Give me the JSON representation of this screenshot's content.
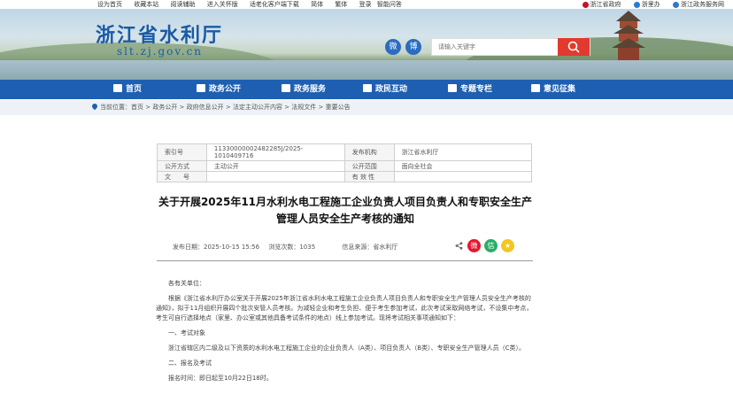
{
  "topbar": {
    "links": [
      "设为首页",
      "收藏本站",
      "阅读辅助",
      "进入关怀版",
      "适老化客户端下载",
      "简体",
      "繁体",
      "登录",
      "智能问答"
    ],
    "right": [
      "浙江省政府",
      "浙里办",
      "浙江政务服务网"
    ]
  },
  "site": {
    "title": "浙江省水利厅",
    "url": "slt.zj.gov.cn"
  },
  "social": {
    "wechat": "微",
    "weibo": "博"
  },
  "search": {
    "placeholder": "请输入关键字"
  },
  "nav": [
    "首页",
    "政务公开",
    "政务服务",
    "政民互动",
    "专题专栏",
    "意见征集"
  ],
  "breadcrumb": {
    "text": "当前位置：首页 > 政务公开 > 政府信息公开 > 法定主动公开内容 > 法规文件 > 重要公告"
  },
  "meta": {
    "index_label": "索引号",
    "index_value": "11330000002482285J/2025-1010409716",
    "publisher_label": "发布机构",
    "publisher_value": "浙江省水利厅",
    "method_label": "公开方式",
    "method_value": "主动公开",
    "scope_label": "公开范围",
    "scope_value": "面向全社会",
    "docno_label": "文　　号",
    "docno_value": "",
    "validity_label": "有 效 性",
    "validity_value": ""
  },
  "article": {
    "title": "关于开展2025年11月水利水电工程施工企业负责人项目负责人和专职安全生产管理人员安全生产考核的通知",
    "date_label": "发布日期：2025-10-15 15:56",
    "views_label": "浏览次数：1035",
    "source_label": "信息来源：省水利厅",
    "para1": "各有关单位：",
    "para2": "根据《浙江省水利厅办公室关于开展2025年浙江省水利水电工程施工企业负责人项目负责人和专职安全生产管理人员安全生产考核的通知》，拟于11月组织开展四个批次安管人员考核。为减轻企业和考生负担、便于考生参加考试，此次考试采取网络考试，不设集中考点，考生可自行选择地点（家里、办公室或其他具备考试条件的地点）线上参加考试。现将考试相关事项通知如下：",
    "para3": "一、考试对象",
    "para4": "浙江省辖区内二级及以下资质的水利水电工程施工企业的企业负责人（A类）、项目负责人（B类）、专职安全生产管理人员（C类）。",
    "para5": "二、报名及考试",
    "para6": "报名时间：即日起至10月22日18时。"
  },
  "colors": {
    "brand": "#1f5fb2",
    "accent": "#e23a2e"
  }
}
